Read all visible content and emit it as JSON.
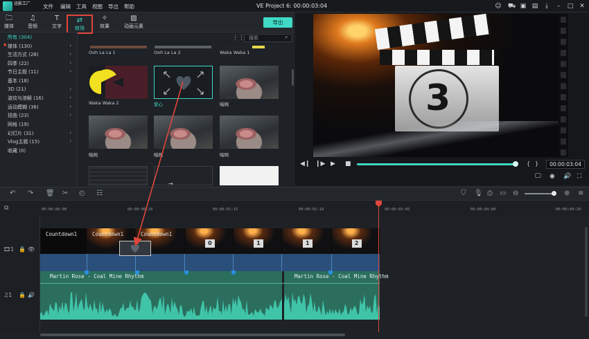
{
  "titlebar": {
    "app_name": "迅影工厂",
    "menu": [
      "文件",
      "编辑",
      "工具",
      "视图",
      "导出",
      "帮助"
    ],
    "project_title": "VE Project 6: 00:00:03:04",
    "icons": [
      "user-icon",
      "cart-icon",
      "box-icon",
      "gift-icon",
      "download-icon",
      "minimize-icon",
      "maximize-icon",
      "close-icon"
    ]
  },
  "toolbar": {
    "tabs": [
      {
        "label": "媒体",
        "icon": "folder-icon"
      },
      {
        "label": "音频",
        "icon": "music-icon"
      },
      {
        "label": "文字",
        "icon": "text-icon"
      },
      {
        "label": "转场",
        "icon": "transition-icon"
      },
      {
        "label": "效果",
        "icon": "effect-icon"
      },
      {
        "label": "动画元素",
        "icon": "image-icon"
      }
    ],
    "export_label": "导出"
  },
  "categories": [
    {
      "label": "所有 (304)",
      "active": true
    },
    {
      "label": "媒体 (130)",
      "dot": true
    },
    {
      "label": "生活方式 (28)"
    },
    {
      "label": "四季 (22)"
    },
    {
      "label": "节日主题 (11)"
    },
    {
      "label": "基本 (18)"
    },
    {
      "label": "3D (21)"
    },
    {
      "label": "波纹与溶解 (16)"
    },
    {
      "label": "运动模糊 (36)"
    },
    {
      "label": "扭曲 (23)"
    },
    {
      "label": "网格 (19)"
    },
    {
      "label": "幻灯片 (31)"
    },
    {
      "label": "Vlog主题 (15)"
    },
    {
      "label": "收藏 (0)"
    }
  ],
  "search": {
    "placeholder": "搜索"
  },
  "tiles": [
    {
      "label": "Ooh La La 1"
    },
    {
      "label": "Ooh La La 2"
    },
    {
      "label": "Waka Waka 1"
    },
    {
      "label": "Waka Waka 2"
    },
    {
      "label": "爱心"
    },
    {
      "label": "暗网"
    },
    {
      "label": "暗网"
    },
    {
      "label": "暗网"
    },
    {
      "label": "暗网"
    }
  ],
  "preview": {
    "clapper_number": "3",
    "timecode": "00:00:03:04",
    "progress": 1.0
  },
  "ruler": [
    "00:00:00:00",
    "00:00:00:20",
    "00:00:01:15",
    "00:00:02:10",
    "00:00:03:05",
    "00:00:04:00",
    "00:00:04:20"
  ],
  "video_clips": [
    {
      "name": "Countdown1"
    },
    {
      "name": "Countdown1"
    },
    {
      "name": "Countdown1",
      "num": ""
    },
    {
      "name": "",
      "num": "0"
    },
    {
      "name": "",
      "num": "1"
    },
    {
      "name": "",
      "num": "1"
    },
    {
      "name": "",
      "num": "2"
    }
  ],
  "audio_clips": [
    {
      "name": "Martin Rose - Coal Mine Rhythm"
    },
    {
      "name": "Martin Rose - Coal Mine Rhythm"
    }
  ],
  "colors": {
    "accent": "#3fd9c6",
    "highlight": "#e0463b",
    "video_strip": "#2a4f7a",
    "audio": "#2b6e5e"
  }
}
